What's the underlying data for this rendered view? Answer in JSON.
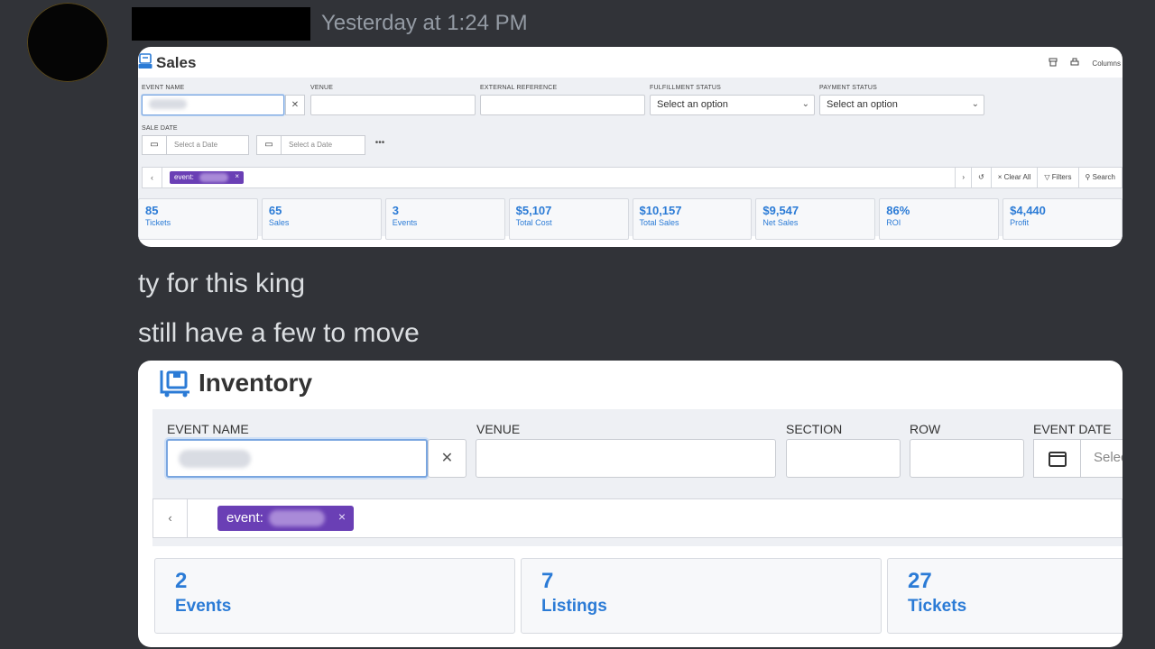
{
  "chat": {
    "timestamp": "Yesterday at 1:24 PM",
    "message_lines": [
      "ty for this king",
      "still have a few to move"
    ]
  },
  "sales": {
    "title": "Sales",
    "toolbar": {
      "columns_label": "Columns"
    },
    "filters": {
      "event_name_label": "EVENT NAME",
      "venue_label": "VENUE",
      "external_reference_label": "EXTERNAL REFERENCE",
      "fulfillment_status_label": "FULFILLMENT STATUS",
      "fulfillment_status_value": "Select an option",
      "payment_status_label": "PAYMENT STATUS",
      "payment_status_value": "Select an option",
      "sale_date_label": "SALE DATE",
      "date_placeholder_1": "Select a Date",
      "date_placeholder_2": "Select a Date",
      "more_label": "•••"
    },
    "chip": {
      "label": "event:",
      "remove": "×"
    },
    "chip_tools": {
      "clear_all": "× Clear All",
      "filters": "Filters",
      "search": "Search"
    },
    "stats": [
      {
        "value": "85",
        "label": "Tickets"
      },
      {
        "value": "65",
        "label": "Sales"
      },
      {
        "value": "3",
        "label": "Events"
      },
      {
        "value": "$5,107",
        "label": "Total Cost"
      },
      {
        "value": "$10,157",
        "label": "Total Sales"
      },
      {
        "value": "$9,547",
        "label": "Net Sales"
      },
      {
        "value": "86%",
        "label": "ROI"
      },
      {
        "value": "$4,440",
        "label": "Profit"
      }
    ]
  },
  "inventory": {
    "title": "Inventory",
    "filters": {
      "event_name_label": "EVENT NAME",
      "venue_label": "VENUE",
      "section_label": "SECTION",
      "row_label": "ROW",
      "event_date_label": "EVENT DATE",
      "date_placeholder": "Selec"
    },
    "chip": {
      "label": "event:",
      "remove": "×"
    },
    "stats": [
      {
        "value": "2",
        "label": "Events"
      },
      {
        "value": "7",
        "label": "Listings"
      },
      {
        "value": "27",
        "label": "Tickets"
      }
    ]
  },
  "colors": {
    "background": "#313338",
    "accent_blue": "#2b7bd6",
    "chip_purple": "#6a3fb5",
    "timestamp_gray": "#949ba4"
  }
}
